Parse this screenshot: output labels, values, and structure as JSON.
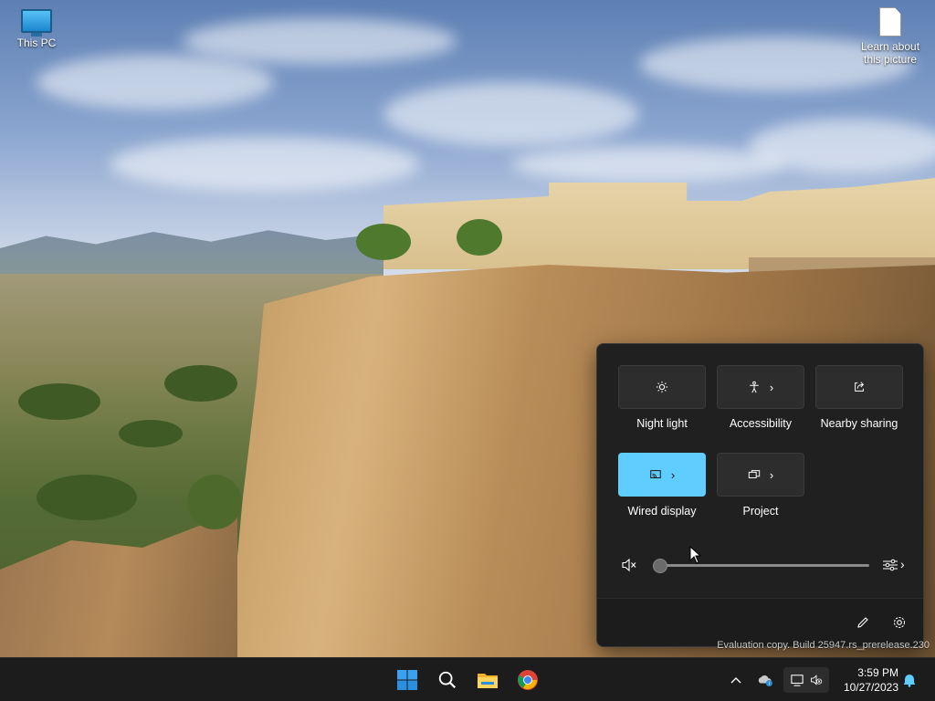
{
  "desktop": {
    "icons": [
      {
        "label": "This PC",
        "icon": "monitor-icon"
      },
      {
        "label": "Learn about this picture",
        "icon": "document-icon"
      }
    ],
    "watermark": "Evaluation copy. Build 25947.rs_prerelease.230"
  },
  "quick_settings": {
    "tiles": [
      {
        "label": "Night light",
        "icon": "brightness-sun-icon",
        "active": false,
        "has_chevron": false
      },
      {
        "label": "Accessibility",
        "icon": "accessibility-icon",
        "active": false,
        "has_chevron": true
      },
      {
        "label": "Nearby sharing",
        "icon": "share-icon",
        "active": false,
        "has_chevron": false
      },
      {
        "label": "Wired display",
        "icon": "cast-display-icon",
        "active": true,
        "has_chevron": true
      },
      {
        "label": "Project",
        "icon": "project-icon",
        "active": false,
        "has_chevron": true
      }
    ],
    "volume": {
      "muted": true,
      "level": 0,
      "icon": "speaker-muted-icon"
    },
    "footer": {
      "edit_icon": "pencil-icon",
      "settings_icon": "gear-icon"
    }
  },
  "taskbar": {
    "apps": [
      "start-icon",
      "search-icon",
      "file-explorer-icon",
      "chrome-icon"
    ],
    "tray": [
      "chevron-up-icon",
      "onedrive-icon",
      "network-icon",
      "volume-muted-icon"
    ],
    "time": "3:59 PM",
    "date": "10/27/2023"
  },
  "colors": {
    "accent": "#60cdff",
    "panel_bg": "#202020",
    "taskbar_bg": "#1c1c1c"
  }
}
